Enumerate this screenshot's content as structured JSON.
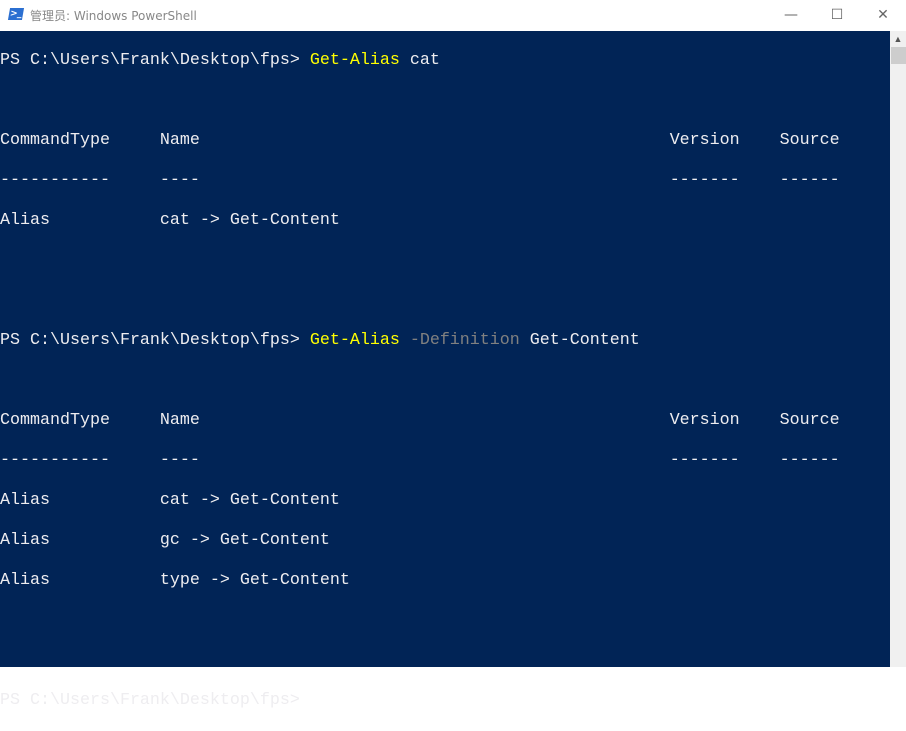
{
  "window": {
    "title": "管理员: Windows PowerShell",
    "icon": "powershell-icon",
    "minimize": "—",
    "maximize": "☐",
    "close": "✕"
  },
  "colors": {
    "background": "#012456",
    "text": "#eeedf0",
    "command": "#ffff00",
    "parameter": "#808080"
  },
  "terminal": {
    "prompt": "PS C:\\Users\\Frank\\Desktop\\fps> ",
    "commands": [
      {
        "cmd": "Get-Alias",
        "param": "",
        "arg": "cat"
      },
      {
        "cmd": "Get-Alias",
        "param": "-Definition",
        "arg": "Get-Content"
      }
    ],
    "header": "CommandType     Name                                               Version    Source",
    "dashes": "-----------     ----                                               -------    ------",
    "result1": [
      "Alias           cat -> Get-Content"
    ],
    "result2": [
      "Alias           cat -> Get-Content",
      "Alias           gc -> Get-Content",
      "Alias           type -> Get-Content"
    ]
  }
}
